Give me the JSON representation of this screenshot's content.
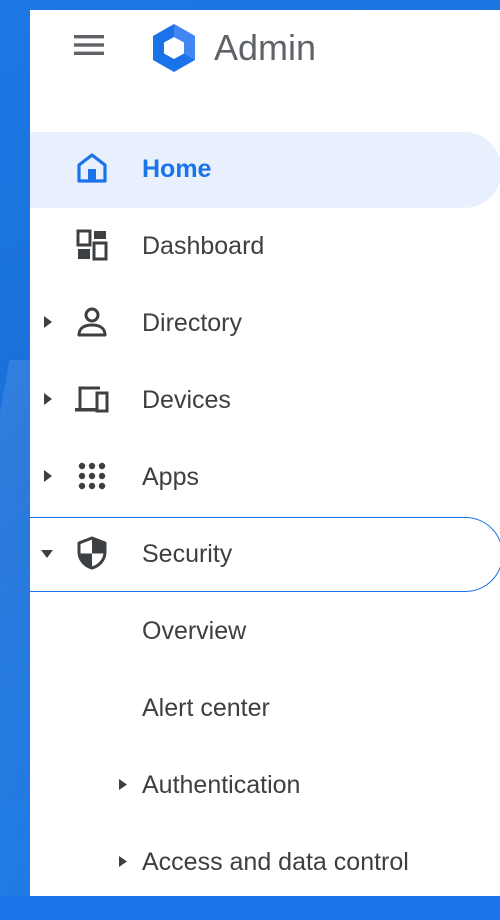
{
  "app": {
    "title": "Admin"
  },
  "nav": {
    "items": [
      {
        "label": "Home",
        "icon": "home-icon"
      },
      {
        "label": "Dashboard",
        "icon": "dashboard-icon"
      },
      {
        "label": "Directory",
        "icon": "person-icon"
      },
      {
        "label": "Devices",
        "icon": "devices-icon"
      },
      {
        "label": "Apps",
        "icon": "apps-grid-icon"
      },
      {
        "label": "Security",
        "icon": "shield-icon"
      }
    ],
    "security_children": [
      {
        "label": "Overview"
      },
      {
        "label": "Alert center"
      },
      {
        "label": "Authentication"
      },
      {
        "label": "Access and data control"
      }
    ]
  },
  "colors": {
    "accent": "#1a73e8",
    "active_bg": "#e8f0fe",
    "text": "#3c4043",
    "icon": "#5f6368",
    "desktop": "#1a73e8"
  }
}
